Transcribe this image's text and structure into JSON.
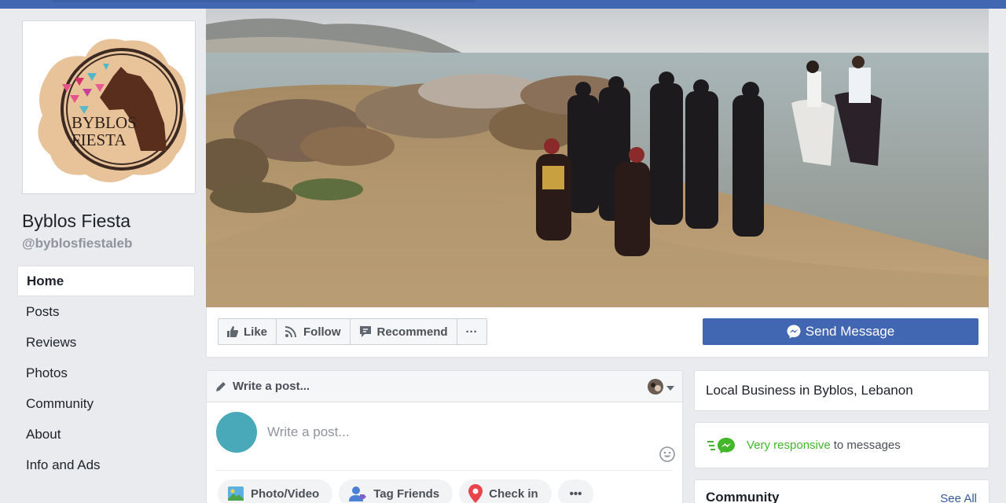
{
  "page": {
    "name": "Byblos Fiesta",
    "handle": "@byblosfiestaleb",
    "logo_text_line1": "BYBLOS",
    "logo_text_line2": "FIESTA"
  },
  "nav": {
    "items": [
      {
        "label": "Home",
        "active": true
      },
      {
        "label": "Posts"
      },
      {
        "label": "Reviews"
      },
      {
        "label": "Photos"
      },
      {
        "label": "Community"
      },
      {
        "label": "About"
      },
      {
        "label": "Info and Ads"
      }
    ]
  },
  "actions": {
    "like": "Like",
    "follow": "Follow",
    "recommend": "Recommend",
    "more": "···",
    "send_message": "Send Message"
  },
  "composer": {
    "header": "Write a post...",
    "placeholder": "Write a post...",
    "chips": {
      "photo_video": "Photo/Video",
      "tag_friends": "Tag Friends",
      "check_in": "Check in",
      "more": "•••"
    }
  },
  "sidebar": {
    "category": "Local Business in Byblos, Lebanon",
    "responsive_strong": "Very responsive",
    "responsive_rest": "to messages",
    "community_title": "Community",
    "see_all": "See All"
  },
  "colors": {
    "brand": "#4267b2",
    "responsive_green": "#42b72a",
    "link": "#385898"
  }
}
